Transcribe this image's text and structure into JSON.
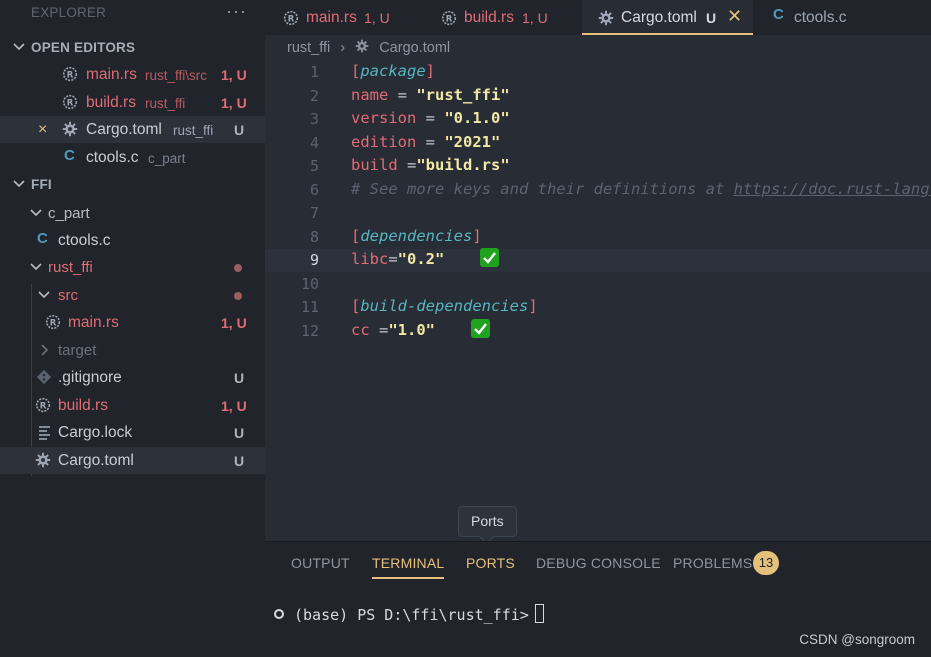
{
  "sidebar": {
    "title": "EXPLORER",
    "more": "···",
    "open_editors": {
      "label": "OPEN EDITORS",
      "items": [
        {
          "name": "main.rs",
          "desc": "rust_ffi\\src",
          "status": "1, U"
        },
        {
          "name": "build.rs",
          "desc": "rust_ffi",
          "status": "1, U"
        },
        {
          "name": "Cargo.toml",
          "desc": "rust_ffi",
          "status": "U",
          "close": "×"
        },
        {
          "name": "ctools.c",
          "desc": "c_part",
          "status": ""
        }
      ]
    },
    "workspace": {
      "label": "FFI",
      "c_part": "c_part",
      "ctools": "ctools.c",
      "rust_ffi": "rust_ffi",
      "src": "src",
      "main_rs": "main.rs",
      "main_rs_status": "1, U",
      "target": "target",
      "gitignore": ".gitignore",
      "gitignore_status": "U",
      "build_rs": "build.rs",
      "build_rs_status": "1, U",
      "cargo_lock": "Cargo.lock",
      "cargo_lock_status": "U",
      "cargo_toml": "Cargo.toml",
      "cargo_toml_status": "U"
    }
  },
  "tabs": [
    {
      "name": "main.rs",
      "status": "1, U"
    },
    {
      "name": "build.rs",
      "status": "1, U"
    },
    {
      "name": "Cargo.toml",
      "status": "U",
      "close": "✕"
    },
    {
      "name": "ctools.c",
      "icon_letter": "C"
    }
  ],
  "breadcrumb": {
    "folder": "rust_ffi",
    "sep": "›",
    "file": "Cargo.toml"
  },
  "editor": {
    "lines": [
      {
        "n": "1",
        "open": "[",
        "section": "package",
        "close": "]"
      },
      {
        "n": "2",
        "key": "name",
        "op": " = ",
        "val": "\"rust_ffi\""
      },
      {
        "n": "3",
        "key": "version",
        "op": " = ",
        "val": "\"0.1.0\""
      },
      {
        "n": "4",
        "key": "edition",
        "op": " = ",
        "val": "\"2021\""
      },
      {
        "n": "5",
        "key": "build",
        "op": " =",
        "val": "\"build.rs\""
      },
      {
        "n": "6",
        "comment": "# See more keys and their definitions at ",
        "link": "https://doc.rust-lang.org/cargo/reference/manifest.html"
      },
      {
        "n": "7"
      },
      {
        "n": "8",
        "open": "[",
        "section": "dependencies",
        "close": "]"
      },
      {
        "n": "9",
        "key": "libc",
        "op": "=",
        "val": "\"0.2\""
      },
      {
        "n": "10"
      },
      {
        "n": "11",
        "open": "[",
        "section": "build-dependencies",
        "close": "]"
      },
      {
        "n": "12",
        "key": "cc",
        "op": " =",
        "val": "\"1.0\""
      }
    ]
  },
  "tooltip": "Ports",
  "panel": {
    "tabs": [
      "OUTPUT",
      "TERMINAL",
      "PORTS",
      "DEBUG CONSOLE",
      "PROBLEMS"
    ],
    "problems_count": "13",
    "terminal_prompt": "(base) PS D:\\ffi\\rust_ffi>"
  },
  "watermark": "CSDN @songroom",
  "colors": {
    "accent": "#e5c07b",
    "modified": "#e06c75",
    "check": "#1fa31f"
  }
}
